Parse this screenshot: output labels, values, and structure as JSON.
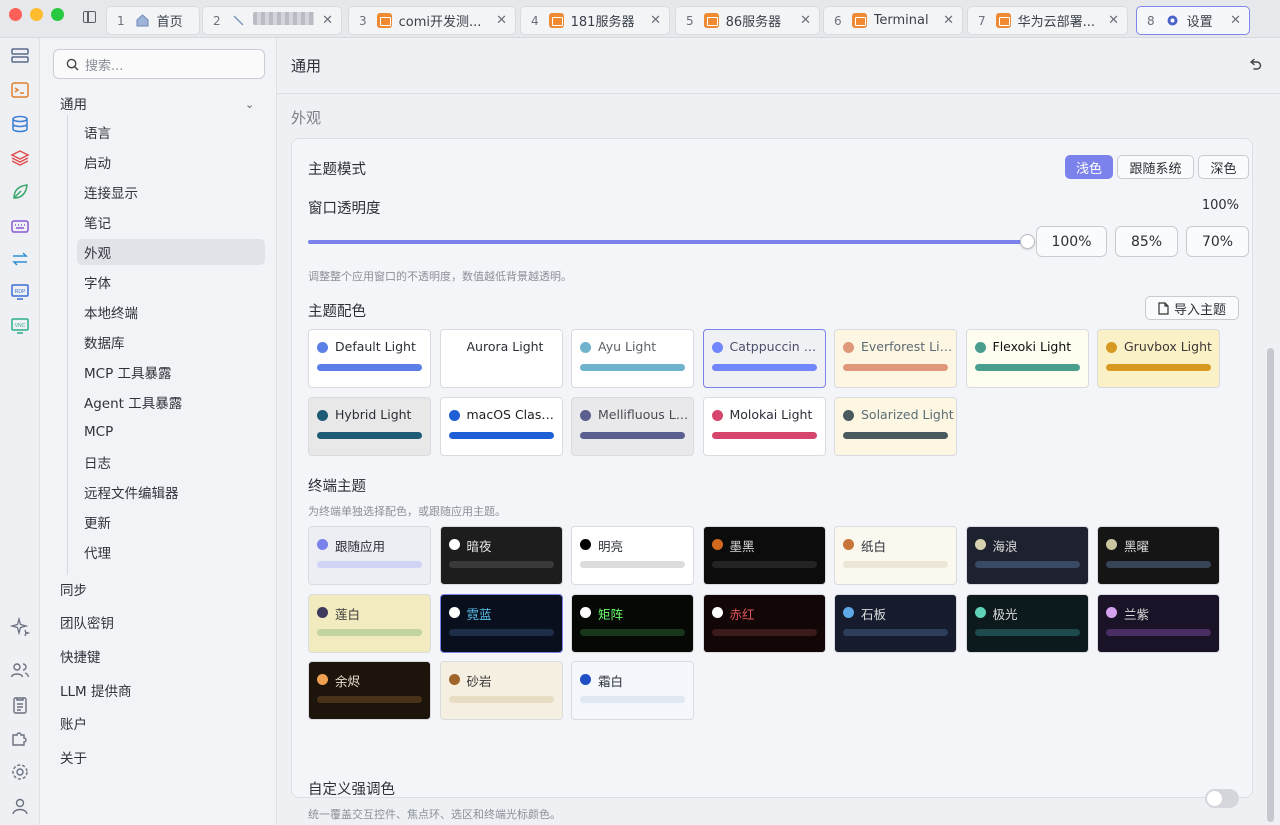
{
  "tabs": [
    {
      "num": "1",
      "label": "首页",
      "icon": "home-icon"
    },
    {
      "num": "2",
      "label": "",
      "icon": "connection-icon"
    },
    {
      "num": "3",
      "label": "comi开发测...",
      "icon": "terminal-icon"
    },
    {
      "num": "4",
      "label": "181服务器",
      "icon": "terminal-icon"
    },
    {
      "num": "5",
      "label": "86服务器",
      "icon": "terminal-icon"
    },
    {
      "num": "6",
      "label": "Terminal",
      "icon": "terminal-icon"
    },
    {
      "num": "7",
      "label": "华为云部署...",
      "icon": "terminal-icon"
    },
    {
      "num": "8",
      "label": "设置",
      "icon": "gear-icon"
    }
  ],
  "rail_icons": [
    "hosts-icon",
    "terminal-icon",
    "database-icon",
    "layers-icon",
    "leaf-icon",
    "keyboard-icon",
    "transfer-icon",
    "rdp-icon",
    "vnc-icon",
    "sparkle-icon",
    "users-icon",
    "clipboard-icon",
    "puzzle-icon",
    "gear-icon",
    "user-icon"
  ],
  "rail_labels": {
    "rdp": "RDP",
    "vnc": "VNC"
  },
  "nav": {
    "search_placeholder": "搜索...",
    "general": "通用",
    "general_items": [
      "语言",
      "启动",
      "连接显示",
      "笔记",
      "外观",
      "字体",
      "本地终端",
      "数据库",
      "MCP 工具暴露",
      "Agent 工具暴露",
      "MCP",
      "日志",
      "远程文件编辑器",
      "更新",
      "代理"
    ],
    "active_index": 4,
    "top_items": [
      "同步",
      "团队密钥",
      "快捷键",
      "LLM 提供商",
      "账户",
      "关于"
    ]
  },
  "header": {
    "title": "通用"
  },
  "appearance": {
    "section_title": "外观",
    "theme_mode": {
      "label": "主题模式",
      "options": [
        "浅色",
        "跟随系统",
        "深色"
      ],
      "selected": "浅色"
    },
    "opacity": {
      "label": "窗口透明度",
      "value_text": "100%",
      "value": 1.0,
      "presets": [
        "100%",
        "85%",
        "70%"
      ],
      "hint": "调整整个应用窗口的不透明度，数值越低背景越透明。"
    },
    "color_scheme": {
      "label": "主题配色",
      "import_label": "导入主题",
      "selected": "Catppuccin Latte",
      "themes": [
        {
          "name": "Default Light",
          "dot": "#5b7fe6",
          "bar": "#5b7fe6",
          "bg": "#ffffff",
          "fg": "#2b2f38"
        },
        {
          "name": "Aurora Light",
          "dot": "",
          "bar": "",
          "bg": "#ffffff",
          "fg": "#2b2f38"
        },
        {
          "name": "Ayu Light",
          "dot": "#6fb3cc",
          "bar": "#6fb3cc",
          "bg": "#ffffff",
          "fg": "#5c6166"
        },
        {
          "name": "Catppuccin Latte",
          "dot": "#7287fd",
          "bar": "#7287fd",
          "bg": "#eff1f5",
          "fg": "#4c4f69"
        },
        {
          "name": "Everforest Light",
          "dot": "#e0987a",
          "bar": "#e0987a",
          "bg": "#fdf6e3",
          "fg": "#5c6a72"
        },
        {
          "name": "Flexoki Light",
          "dot": "#4a9e8e",
          "bar": "#4a9e8e",
          "bg": "#fffcf0",
          "fg": "#100f0f"
        },
        {
          "name": "Gruvbox Light",
          "dot": "#d79921",
          "bar": "#d79921",
          "bg": "#fbf1c7",
          "fg": "#3c3836"
        },
        {
          "name": "Hybrid Light",
          "dot": "#1d5a74",
          "bar": "#1d5a74",
          "bg": "#e8e8e8",
          "fg": "#2b2f38"
        },
        {
          "name": "macOS Classic...",
          "dot": "#1f5fd6",
          "bar": "#1f5fd6",
          "bg": "#ffffff",
          "fg": "#1e1e1e"
        },
        {
          "name": "Mellifluous Light",
          "dot": "#5a5f8f",
          "bar": "#5a5f8f",
          "bg": "#e9e9eb",
          "fg": "#4a4a55"
        },
        {
          "name": "Molokai Light",
          "dot": "#d6456b",
          "bar": "#d6456b",
          "bg": "#ffffff",
          "fg": "#2b2f38"
        },
        {
          "name": "Solarized Light",
          "dot": "#4b5a5e",
          "bar": "#4b5a5e",
          "bg": "#fdf6e3",
          "fg": "#586e75"
        }
      ]
    },
    "terminal_theme": {
      "label": "终端主题",
      "hint": "为终端单独选择配色，或跟随应用主题。",
      "selected": "霓蓝",
      "themes": [
        {
          "name": "跟随应用",
          "dot": "#7b82ec",
          "bar": "#cfd3f4",
          "bg": "#eceef3",
          "fg": "#2b2f38"
        },
        {
          "name": "暗夜",
          "dot": "#ffffff",
          "bar": "#3a3a3a",
          "bg": "#1d1d1d",
          "fg": "#e8e8e8"
        },
        {
          "name": "明亮",
          "dot": "#000000",
          "bar": "#dcdcdc",
          "bg": "#ffffff",
          "fg": "#2b2f38"
        },
        {
          "name": "墨黑",
          "dot": "#d2691e",
          "bar": "#242424",
          "bg": "#0c0c0c",
          "fg": "#d8d8d8"
        },
        {
          "name": "纸白",
          "dot": "#c8753a",
          "bar": "#ebe6d6",
          "bg": "#fbf8ef",
          "fg": "#2b2f38"
        },
        {
          "name": "海浪",
          "dot": "#d9d2b0",
          "bar": "#3a4a64",
          "bg": "#1e2230",
          "fg": "#dcdcdc"
        },
        {
          "name": "黑曜",
          "dot": "#c9c6a0",
          "bar": "#364456",
          "bg": "#151515",
          "fg": "#dcdcdc"
        },
        {
          "name": "莲白",
          "dot": "#3d3a5c",
          "bar": "#c2d4a0",
          "bg": "#f2ebbf",
          "fg": "#3a3a3a"
        },
        {
          "name": "霓蓝",
          "dot": "#ffffff",
          "bar": "#1e2d48",
          "bg": "#0a0f1e",
          "fg": "#5bc0eb"
        },
        {
          "name": "矩阵",
          "dot": "#ffffff",
          "bar": "#17361a",
          "bg": "#050805",
          "fg": "#6aff6a"
        },
        {
          "name": "赤红",
          "dot": "#ffffff",
          "bar": "#3a1a1a",
          "bg": "#120606",
          "fg": "#e0555a"
        },
        {
          "name": "石板",
          "dot": "#5ea8e8",
          "bar": "#2e3d5c",
          "bg": "#161c2e",
          "fg": "#dcdcdc"
        },
        {
          "name": "极光",
          "dot": "#5fd3b8",
          "bar": "#1d4a4c",
          "bg": "#0c1a1e",
          "fg": "#dcdcdc"
        },
        {
          "name": "兰紫",
          "dot": "#d6a0f0",
          "bar": "#4a2d62",
          "bg": "#1a1226",
          "fg": "#dcdcdc"
        },
        {
          "name": "余烬",
          "dot": "#f0a050",
          "bar": "#4a3218",
          "bg": "#1d140c",
          "fg": "#e8e0d0"
        },
        {
          "name": "砂岩",
          "dot": "#a0652a",
          "bar": "#e8dcc4",
          "bg": "#f5efe1",
          "fg": "#3a3a3a"
        },
        {
          "name": "霜白",
          "dot": "#1f4fc4",
          "bar": "#e0e8f2",
          "bg": "#f4f7fb",
          "fg": "#2b2f38"
        }
      ]
    },
    "accent": {
      "label": "自定义强调色",
      "hint": "统一覆盖交互控件、焦点环、选区和终端光标颜色。",
      "enabled": false
    }
  },
  "colors": {
    "accent": "#7b82ec"
  }
}
